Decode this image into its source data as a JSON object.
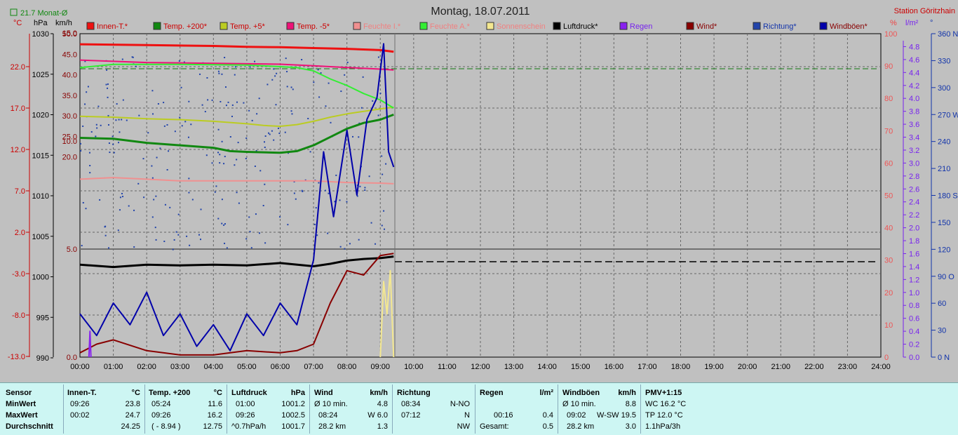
{
  "window": {
    "title": "Montag, 18.07.2011",
    "station": "Station Göritzhain",
    "month_avg": "21.7 Monat-Ø"
  },
  "colors": {
    "innen": "#ee1111",
    "temp200": "#118811",
    "temp5": "#bbcc22",
    "tempm5": "#ee1177",
    "feuchteI": "#f09090",
    "feuchteA": "#33ee33",
    "sonne": "#f4e890",
    "luftdruck": "#000000",
    "regen": "#8822ee",
    "wind": "#880000",
    "richtung": "#2244aa",
    "windboen": "#0000aa"
  },
  "axes": {
    "temp": {
      "unit": "°C",
      "ticks": [
        "22.0",
        "17.0",
        "12.0",
        "7.0",
        "2.0",
        "-3.0",
        "-8.0",
        "-13.0"
      ]
    },
    "hpa": {
      "unit": "hPa",
      "ticks": [
        "1030",
        "1025",
        "1020",
        "1015",
        "1010",
        "1005",
        "1000",
        "995",
        "990"
      ]
    },
    "kmh": {
      "unit": "km/h",
      "ticks": [
        "50.0",
        "45.0",
        "40.0",
        "35.0",
        "30.0",
        "25.0",
        "20.0",
        "15.0",
        "10.0",
        "5.0",
        "0.0"
      ]
    },
    "pct": {
      "unit": "%",
      "ticks": [
        "100",
        "90",
        "80",
        "70",
        "60",
        "50",
        "40",
        "30",
        "20",
        "10",
        "0"
      ]
    },
    "rain": {
      "unit": "l/m²",
      "ticks": [
        "4.8",
        "4.6",
        "4.4",
        "4.2",
        "4.0",
        "3.8",
        "3.6",
        "3.4",
        "3.2",
        "3.0",
        "2.8",
        "2.6",
        "2.4",
        "2.2",
        "2.0",
        "1.8",
        "1.6",
        "1.4",
        "1.2",
        "1.0",
        "0.8",
        "0.6",
        "0.4",
        "0.2",
        "0.0"
      ]
    },
    "dir": {
      "unit": "°",
      "ticks": [
        "360 N",
        "330",
        "300",
        "270 W",
        "240",
        "210",
        "180 S",
        "150",
        "120",
        "90 O",
        "60",
        "30",
        "0 N"
      ]
    },
    "time": {
      "ticks": [
        "00:00",
        "01:00",
        "02:00",
        "03:00",
        "04:00",
        "05:00",
        "06:00",
        "07:00",
        "08:00",
        "09:00",
        "10:00",
        "11:00",
        "12:00",
        "13:00",
        "14:00",
        "15:00",
        "16:00",
        "17:00",
        "18:00",
        "19:00",
        "20:00",
        "21:00",
        "22:00",
        "23:00",
        "24:00"
      ]
    }
  },
  "legend": [
    {
      "label": "Innen-T.*",
      "color": "#ee1111",
      "text": "#cc0000"
    },
    {
      "label": "Temp. +200*",
      "color": "#118811",
      "text": "#cc0000"
    },
    {
      "label": "Temp. +5*",
      "color": "#bbcc22",
      "text": "#cc0000"
    },
    {
      "label": "Temp. -5*",
      "color": "#ee1177",
      "text": "#cc0000"
    },
    {
      "label": "Feuchte I.*",
      "color": "#f09090",
      "text": "#f08080"
    },
    {
      "label": "Feuchte A.*",
      "color": "#33ee33",
      "text": "#f08080"
    },
    {
      "label": "Sonnenschein",
      "color": "#f4e890",
      "text": "#f08080"
    },
    {
      "label": "Luftdruck*",
      "color": "#000000",
      "text": "#000000"
    },
    {
      "label": "Regen",
      "color": "#8822ee",
      "text": "#7722ee"
    },
    {
      "label": "Wind*",
      "color": "#880000",
      "text": "#880000"
    },
    {
      "label": "Richtung*",
      "color": "#2244aa",
      "text": "#1133aa"
    },
    {
      "label": "Windböen*",
      "color": "#0000aa",
      "text": "#880000"
    }
  ],
  "chart_data": {
    "type": "line",
    "title": "Montag, 18.07.2011",
    "xlim": [
      "00:00",
      "24:00"
    ],
    "series": [
      {
        "name": "Innen-T.*",
        "axis": "°C",
        "t": [
          0,
          2,
          4,
          5,
          6,
          7,
          8,
          9,
          9.4
        ],
        "v": [
          24.7,
          24.6,
          24.5,
          24.4,
          24.35,
          24.25,
          24.15,
          24.0,
          23.8
        ]
      },
      {
        "name": "Temp. +200*",
        "axis": "°C",
        "t": [
          0,
          1,
          2,
          3,
          4,
          4.5,
          5,
          6,
          6.5,
          7,
          7.5,
          8,
          8.5,
          9,
          9.4
        ],
        "v": [
          13.4,
          13.3,
          12.8,
          12.5,
          12.2,
          11.8,
          11.7,
          11.6,
          11.8,
          12.5,
          13.5,
          14.5,
          15.2,
          15.6,
          16.2
        ]
      },
      {
        "name": "Temp. +5*",
        "axis": "°C",
        "t": [
          0,
          1,
          2,
          3,
          4,
          5,
          5.5,
          6,
          6.5,
          7,
          7.5,
          8,
          8.5,
          9,
          9.4
        ],
        "v": [
          16.0,
          15.9,
          15.7,
          15.6,
          15.4,
          15.1,
          14.9,
          14.8,
          15.0,
          15.4,
          15.9,
          16.3,
          16.6,
          16.9,
          17.1
        ]
      },
      {
        "name": "Temp. -5*",
        "axis": "°C",
        "t": [
          0,
          2,
          4,
          6,
          7,
          8,
          9,
          9.4
        ],
        "v": [
          22.8,
          22.5,
          22.4,
          22.3,
          22.1,
          21.9,
          21.7,
          21.6
        ]
      },
      {
        "name": "Feuchte I.*",
        "axis": "%",
        "t": [
          0,
          1,
          2,
          3,
          4,
          5,
          6,
          7,
          8,
          9,
          9.4
        ],
        "v": [
          55,
          55.5,
          55,
          54.5,
          54.5,
          54.5,
          54.5,
          54.5,
          54,
          53.8,
          53.6
        ]
      },
      {
        "name": "Feuchte A.*",
        "axis": "%",
        "t": [
          0,
          0.5,
          1,
          2,
          3,
          4,
          5,
          6,
          6.5,
          7,
          7.5,
          8,
          8.5,
          9,
          9.4
        ],
        "v": [
          89.5,
          90,
          90.5,
          90.5,
          90.5,
          90.4,
          90.3,
          89.8,
          89.5,
          88.5,
          86,
          84,
          81.5,
          79.5,
          77
        ]
      },
      {
        "name": "Luftdruck*",
        "axis": "hPa",
        "t": [
          0,
          1,
          2,
          3,
          4,
          5,
          6,
          7,
          7.5,
          8,
          8.5,
          9,
          9.4
        ],
        "v": [
          1001.5,
          1001.2,
          1001.5,
          1001.4,
          1001.5,
          1001.4,
          1001.7,
          1001.3,
          1001.6,
          1002.0,
          1002.2,
          1002.3,
          1002.5
        ]
      },
      {
        "name": "Wind*",
        "axis": "km/h",
        "t": [
          0,
          0.5,
          1,
          2,
          3,
          4,
          5,
          6,
          6.5,
          7,
          7.5,
          8,
          8.5,
          9,
          9.4
        ],
        "v": [
          0.2,
          0.6,
          0.8,
          0.3,
          0.1,
          0.1,
          0.3,
          0.2,
          0.3,
          0.6,
          2.5,
          4.0,
          3.8,
          4.7,
          4.8
        ]
      },
      {
        "name": "Windböen*",
        "axis": "km/h",
        "t": [
          0,
          0.5,
          1,
          1.5,
          2,
          2.5,
          3,
          3.5,
          4,
          4.5,
          5,
          5.5,
          6,
          6.5,
          7,
          7.3,
          7.6,
          8,
          8.3,
          8.6,
          8.9,
          9.1,
          9.25,
          9.4
        ],
        "v": [
          2.0,
          1.0,
          2.5,
          1.5,
          3.0,
          1.0,
          2.0,
          0.5,
          1.5,
          0.3,
          2.0,
          1.0,
          2.5,
          1.5,
          4.5,
          9.5,
          6.5,
          10.5,
          7.5,
          11.0,
          12.0,
          14.5,
          9.5,
          8.8
        ]
      },
      {
        "name": "Regen",
        "axis": "l/m²",
        "t": [
          0.27,
          0.3,
          0.33
        ],
        "v": [
          0,
          0.4,
          0
        ]
      },
      {
        "name": "Sonnenschein",
        "axis": "km/h",
        "t": [
          9.0,
          9.1,
          9.2,
          9.3,
          9.4
        ],
        "v": [
          0,
          3.5,
          2.0,
          4.0,
          0
        ]
      }
    ],
    "reference_lines": [
      {
        "value": "25.0 °C",
        "style": "dashed"
      },
      {
        "value": "1001.5 hPa",
        "style": "dashed"
      }
    ]
  },
  "stats": {
    "sensor": {
      "title": "Sensor",
      "rows": [
        "MinWert",
        "MaxWert",
        "Durchschnitt"
      ]
    },
    "innen": {
      "title": "Innen-T.",
      "unit": "°C",
      "rows": [
        [
          "09:26",
          "23.8"
        ],
        [
          "00:02",
          "24.7"
        ],
        [
          "",
          "24.25"
        ]
      ]
    },
    "temp200": {
      "title": "Temp. +200",
      "unit": "°C",
      "rows": [
        [
          "05:24",
          "11.6"
        ],
        [
          "09:26",
          "16.2"
        ],
        [
          "( - 8.94 )",
          "12.75"
        ]
      ]
    },
    "luft": {
      "title": "Luftdruck",
      "unit": "hPa",
      "rows": [
        [
          "01:00",
          "1001.2"
        ],
        [
          "09:26",
          "1002.5"
        ],
        [
          "^0.7hPa/h",
          "1001.7"
        ]
      ]
    },
    "wind": {
      "title": "Wind",
      "unit": "km/h",
      "rows": [
        [
          "Ø 10 min.",
          "4.8"
        ],
        [
          "08:24",
          "W 6.0"
        ],
        [
          "28.2 km",
          "1.3"
        ]
      ]
    },
    "richtung": {
      "title": "Richtung",
      "unit": "",
      "rows": [
        [
          "08:34",
          "N-NO"
        ],
        [
          "07:12",
          "N"
        ],
        [
          "",
          "NW"
        ]
      ]
    },
    "regen": {
      "title": "Regen",
      "unit": "l/m²",
      "rows": [
        [
          "",
          ""
        ],
        [
          "00:16",
          "0.4"
        ],
        [
          "Gesamt:",
          "0.5"
        ]
      ]
    },
    "boen": {
      "title": "Windböen",
      "unit": "km/h",
      "rows": [
        [
          "Ø 10 min.",
          "8.8"
        ],
        [
          "09:02",
          "W-SW 19.5"
        ],
        [
          "28.2 km",
          "3.0"
        ]
      ]
    },
    "pmv": {
      "title": "PMV+1:15",
      "rows": [
        "WC 16.2 °C",
        "TP 12.0 °C",
        "1.1hPa/3h"
      ]
    }
  }
}
